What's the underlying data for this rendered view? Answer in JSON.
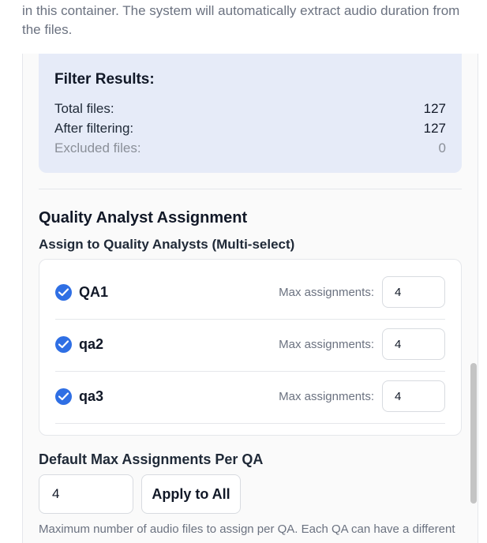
{
  "intro_text": "in this container. The system will automatically extract audio duration from the files.",
  "filter": {
    "title": "Filter Results:",
    "rows": [
      {
        "label": "Total files:",
        "value": "127"
      },
      {
        "label": "After filtering:",
        "value": "127"
      },
      {
        "label": "Excluded files:",
        "value": "0"
      }
    ]
  },
  "qa_section": {
    "title": "Quality Analyst Assignment",
    "subtitle": "Assign to Quality Analysts (Multi-select)",
    "analysts": [
      {
        "name": "QA1",
        "checked": true,
        "max_label": "Max assignments:",
        "max_value": "4"
      },
      {
        "name": "qa2",
        "checked": true,
        "max_label": "Max assignments:",
        "max_value": "4"
      },
      {
        "name": "qa3",
        "checked": true,
        "max_label": "Max assignments:",
        "max_value": "4"
      }
    ]
  },
  "default_max": {
    "title": "Default Max Assignments Per QA",
    "value": "4",
    "apply_label": "Apply to All",
    "hint": "Maximum number of audio files to assign per QA. Each QA can have a different"
  },
  "colors": {
    "accent": "#2f6fe4",
    "filter_bg": "#e6ebf8"
  }
}
